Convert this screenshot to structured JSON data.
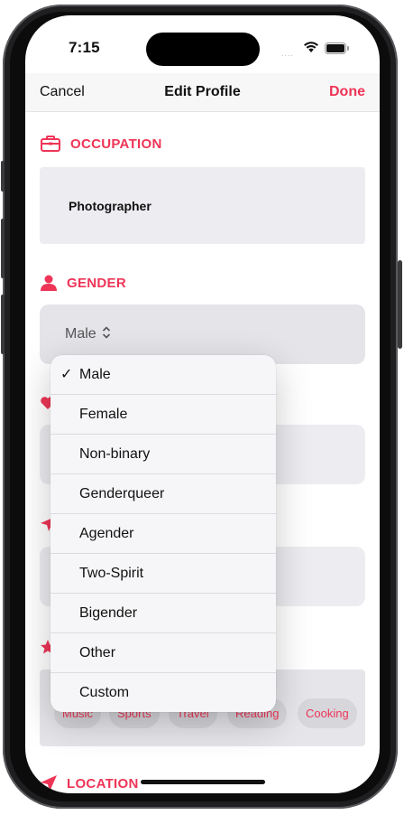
{
  "status": {
    "time": "7:15",
    "signal": "...."
  },
  "nav": {
    "cancel": "Cancel",
    "title": "Edit Profile",
    "done": "Done"
  },
  "occupation": {
    "heading": "OCCUPATION",
    "value": "Photographer"
  },
  "gender": {
    "heading": "GENDER",
    "selected": "Male"
  },
  "gender_menu": {
    "options": [
      "Male",
      "Female",
      "Non-binary",
      "Genderqueer",
      "Agender",
      "Two-Spirit",
      "Bigender",
      "Other",
      "Custom"
    ],
    "checkmark": "✓"
  },
  "interests": {
    "chips": [
      "Music",
      "Sports",
      "Travel",
      "Reading",
      "Cooking"
    ]
  },
  "location": {
    "heading": "LOCATION"
  },
  "colors": {
    "accent": "#ee3557"
  }
}
